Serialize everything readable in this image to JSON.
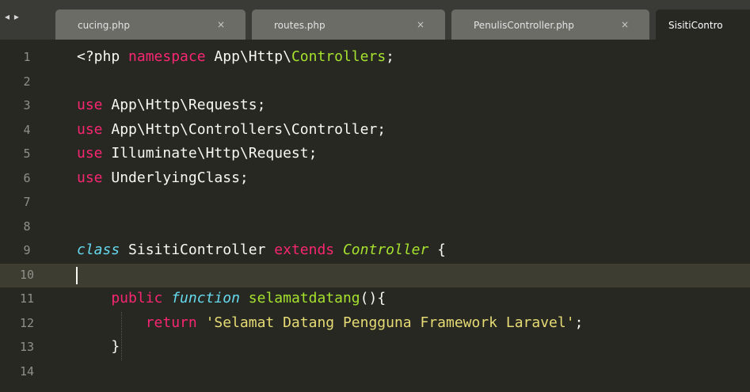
{
  "tabbar": {
    "nav_label": "◂ ▸",
    "tabs": [
      {
        "label": "cucing.php",
        "close": "×"
      },
      {
        "label": "routes.php",
        "close": "×"
      },
      {
        "label": "PenulisController.php",
        "close": "×"
      },
      {
        "label": "SisitiContro",
        "close": ""
      }
    ]
  },
  "colors": {
    "background": "#272822",
    "current_line": "#3e3d32",
    "keyword": "#f92672",
    "storage_type": "#66d9ef",
    "entity_name": "#a6e22e",
    "string": "#e6db74",
    "text": "#f8f8f2",
    "gutter_text": "#8f908a"
  },
  "editor": {
    "current_line": 10,
    "lines": [
      {
        "n": "1",
        "tokens": [
          {
            "t": "<?php ",
            "c": "#f8f8f2"
          },
          {
            "t": "namespace ",
            "c": "#f92672"
          },
          {
            "t": "App\\Http\\",
            "c": "#f8f8f2"
          },
          {
            "t": "Controllers",
            "c": "#a6e22e"
          },
          {
            "t": ";",
            "c": "#f8f8f2"
          }
        ]
      },
      {
        "n": "2",
        "tokens": []
      },
      {
        "n": "3",
        "tokens": [
          {
            "t": "use ",
            "c": "#f92672"
          },
          {
            "t": "App\\Http\\Requests;",
            "c": "#f8f8f2"
          }
        ]
      },
      {
        "n": "4",
        "tokens": [
          {
            "t": "use ",
            "c": "#f92672"
          },
          {
            "t": "App\\Http\\Controllers\\Controller;",
            "c": "#f8f8f2"
          }
        ]
      },
      {
        "n": "5",
        "tokens": [
          {
            "t": "use ",
            "c": "#f92672"
          },
          {
            "t": "Illuminate\\Http\\Request;",
            "c": "#f8f8f2"
          }
        ]
      },
      {
        "n": "6",
        "tokens": [
          {
            "t": "use ",
            "c": "#f92672"
          },
          {
            "t": "UnderlyingClass;",
            "c": "#f8f8f2"
          }
        ]
      },
      {
        "n": "7",
        "tokens": []
      },
      {
        "n": "8",
        "tokens": []
      },
      {
        "n": "9",
        "tokens": [
          {
            "t": "class ",
            "c": "#66d9ef",
            "i": true
          },
          {
            "t": "SisitiController ",
            "c": "#f8f8f2"
          },
          {
            "t": "extends ",
            "c": "#f92672"
          },
          {
            "t": "Controller",
            "c": "#a6e22e",
            "i": true
          },
          {
            "t": " {",
            "c": "#f8f8f2"
          }
        ]
      },
      {
        "n": "10",
        "tokens": []
      },
      {
        "n": "11",
        "tokens": [
          {
            "t": "    public ",
            "c": "#f92672"
          },
          {
            "t": "function ",
            "c": "#66d9ef",
            "i": true
          },
          {
            "t": "selamatdatang",
            "c": "#a6e22e"
          },
          {
            "t": "(){",
            "c": "#f8f8f2"
          }
        ]
      },
      {
        "n": "12",
        "tokens": [
          {
            "t": "        return ",
            "c": "#f92672"
          },
          {
            "t": "'Selamat Datang Pengguna Framework Laravel'",
            "c": "#e6db74"
          },
          {
            "t": ";",
            "c": "#f8f8f2"
          }
        ]
      },
      {
        "n": "13",
        "tokens": [
          {
            "t": "    }",
            "c": "#f8f8f2"
          }
        ]
      },
      {
        "n": "14",
        "tokens": []
      }
    ]
  }
}
